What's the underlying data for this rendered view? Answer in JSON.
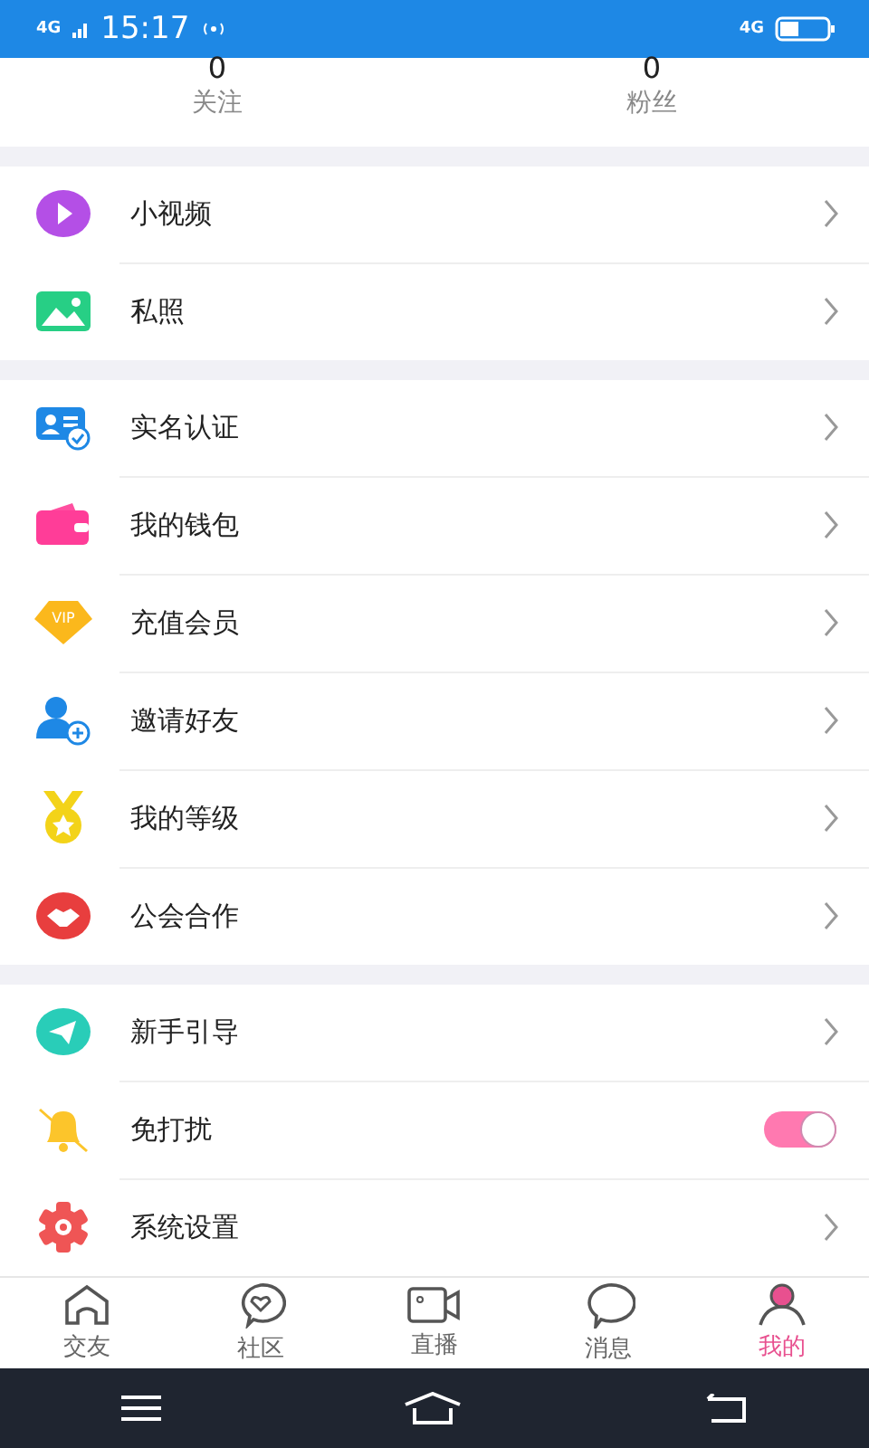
{
  "status_bar": {
    "network": "4G",
    "time": "15:17",
    "network_right": "4G"
  },
  "stats": [
    {
      "value": "0",
      "label": "关注"
    },
    {
      "value": "0",
      "label": "粉丝"
    }
  ],
  "sections": [
    [
      {
        "kind": "link",
        "label": "小视频"
      },
      {
        "kind": "link",
        "label": "私照"
      }
    ],
    [
      {
        "kind": "link",
        "label": "实名认证"
      },
      {
        "kind": "link",
        "label": "我的钱包"
      },
      {
        "kind": "link",
        "label": "充值会员",
        "badge": "VIP"
      },
      {
        "kind": "link",
        "label": "邀请好友"
      },
      {
        "kind": "link",
        "label": "我的等级"
      },
      {
        "kind": "link",
        "label": "公会合作"
      }
    ],
    [
      {
        "kind": "link",
        "label": "新手引导"
      },
      {
        "kind": "toggle",
        "label": "免打扰",
        "on": true
      },
      {
        "kind": "link",
        "label": "系统设置"
      }
    ]
  ],
  "tabs": [
    {
      "label": "交友",
      "selected": false
    },
    {
      "label": "社区",
      "selected": false
    },
    {
      "label": "直播",
      "selected": false
    },
    {
      "label": "消息",
      "selected": false
    },
    {
      "label": "我的",
      "selected": true
    }
  ]
}
